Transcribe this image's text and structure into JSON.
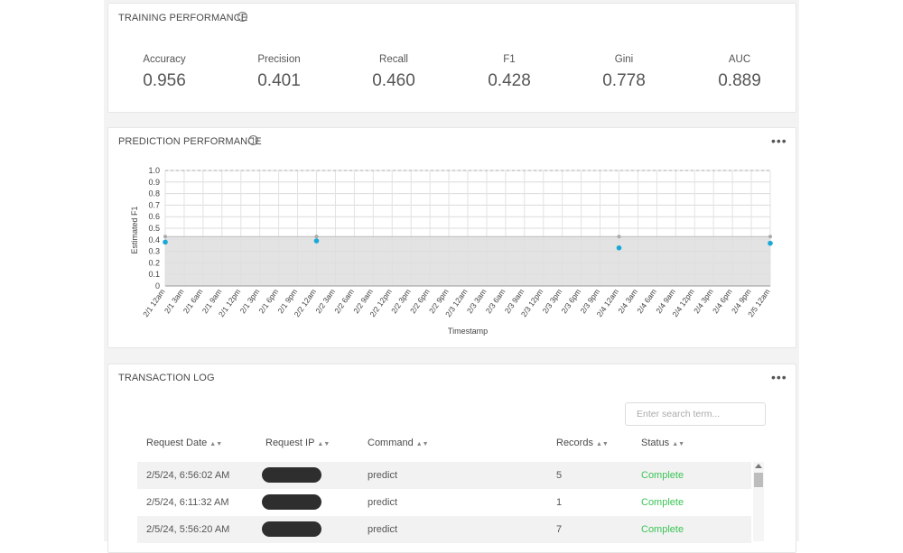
{
  "training": {
    "title": "TRAINING PERFORMANCE",
    "metrics": [
      {
        "label": "Accuracy",
        "value": "0.956"
      },
      {
        "label": "Precision",
        "value": "0.401"
      },
      {
        "label": "Recall",
        "value": "0.460"
      },
      {
        "label": "F1",
        "value": "0.428"
      },
      {
        "label": "Gini",
        "value": "0.778"
      },
      {
        "label": "AUC",
        "value": "0.889"
      }
    ]
  },
  "prediction": {
    "title": "PREDICTION PERFORMANCE"
  },
  "chart_data": {
    "type": "line",
    "xlabel": "Timestamp",
    "ylabel": "Estimated F1",
    "ylim": [
      0,
      1
    ],
    "y_ticks": [
      "0",
      "0.1",
      "0.2",
      "0.3",
      "0.4",
      "0.5",
      "0.6",
      "0.7",
      "0.8",
      "0.9",
      "1.0"
    ],
    "x_ticks": [
      "2/1 12am",
      "2/1 3am",
      "2/1 6am",
      "2/1 9am",
      "2/1 12pm",
      "2/1 3pm",
      "2/1 6pm",
      "2/1 9pm",
      "2/2 12am",
      "2/2 3am",
      "2/2 6am",
      "2/2 9am",
      "2/2 12pm",
      "2/2 3pm",
      "2/2 6pm",
      "2/2 9pm",
      "2/3 12am",
      "2/3 3am",
      "2/3 6am",
      "2/3 9am",
      "2/3 12pm",
      "2/3 3pm",
      "2/3 6pm",
      "2/3 9pm",
      "2/4 12am",
      "2/4 3am",
      "2/4 6am",
      "2/4 9am",
      "2/4 12pm",
      "2/4 3pm",
      "2/4 6pm",
      "2/4 9pm",
      "2/5 12am"
    ],
    "grid": true,
    "upper_band": 1.0,
    "lower_band": 0.428,
    "points": [
      {
        "x": "2/1 12am",
        "y": 0.38
      },
      {
        "x": "2/2 12am",
        "y": 0.39
      },
      {
        "x": "2/4 12am",
        "y": 0.33
      },
      {
        "x": "2/5 12am",
        "y": 0.37
      }
    ],
    "colors": {
      "points": "#1aa9d6",
      "band": "#dedede",
      "line": "#bbbbbb"
    }
  },
  "log": {
    "title": "TRANSACTION LOG",
    "search_placeholder": "Enter search term...",
    "headers": [
      "Request Date",
      "Request IP",
      "Command",
      "Records",
      "Status"
    ],
    "rows": [
      {
        "date": "2/5/24, 6:56:02 AM",
        "command": "predict",
        "records": "5",
        "status": "Complete"
      },
      {
        "date": "2/5/24, 6:11:32 AM",
        "command": "predict",
        "records": "1",
        "status": "Complete"
      },
      {
        "date": "2/5/24, 5:56:20 AM",
        "command": "predict",
        "records": "7",
        "status": "Complete"
      }
    ]
  },
  "colors": {
    "status_complete": "#3cc456",
    "accent": "#1aa9d6"
  }
}
